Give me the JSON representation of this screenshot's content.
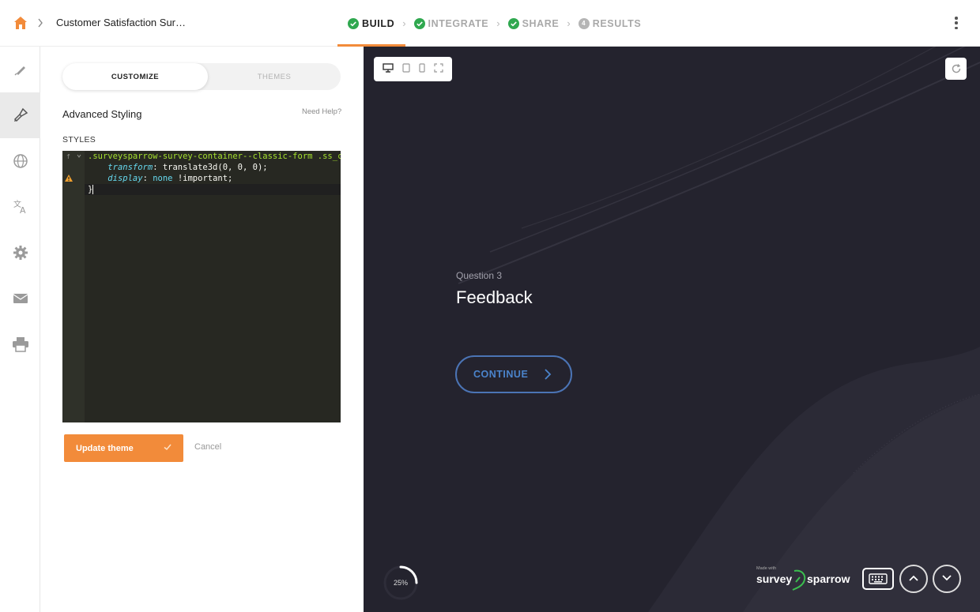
{
  "header": {
    "survey_name": "Customer Satisfaction Sur…",
    "steps": [
      {
        "label": "BUILD",
        "state": "active"
      },
      {
        "label": "INTEGRATE",
        "state": "done"
      },
      {
        "label": "SHARE",
        "state": "done"
      },
      {
        "label": "RESULTS",
        "state": "pending",
        "number": "4"
      }
    ]
  },
  "rail": {
    "items": [
      "edit-icon",
      "paint-brush-icon",
      "globe-icon",
      "translate-icon",
      "gear-icon",
      "mail-icon",
      "print-icon"
    ],
    "active_index": 1
  },
  "panel": {
    "tabs": {
      "customize": "CUSTOMIZE",
      "themes": "THEMES"
    },
    "title": "Advanced Styling",
    "help_link": "Need Help?",
    "styles_label": "STYLES",
    "code": {
      "line1": ".surveysparrow-survey-container--classic-form .ss_cl",
      "line2_prop": "transform",
      "line2_rest": ": translate3d(0, 0, 0);",
      "line3_prop": "display",
      "line3_sep": ": ",
      "line3_val": "none",
      "line3_rest": " !important;",
      "line4": "}"
    },
    "update_label": "Update theme",
    "cancel_label": "Cancel"
  },
  "preview": {
    "question_number": "Question 3",
    "question_title": "Feedback",
    "continue_label": "CONTINUE",
    "progress_text": "25%",
    "progress_value": 0.25,
    "brand": {
      "made_with": "Made with",
      "word1": "survey",
      "word2": "sparrow"
    }
  },
  "colors": {
    "accent": "#f28b3a",
    "check_green": "#2fa84f",
    "preview_bg": "#24232e",
    "continue_blue": "#4b74b5"
  }
}
